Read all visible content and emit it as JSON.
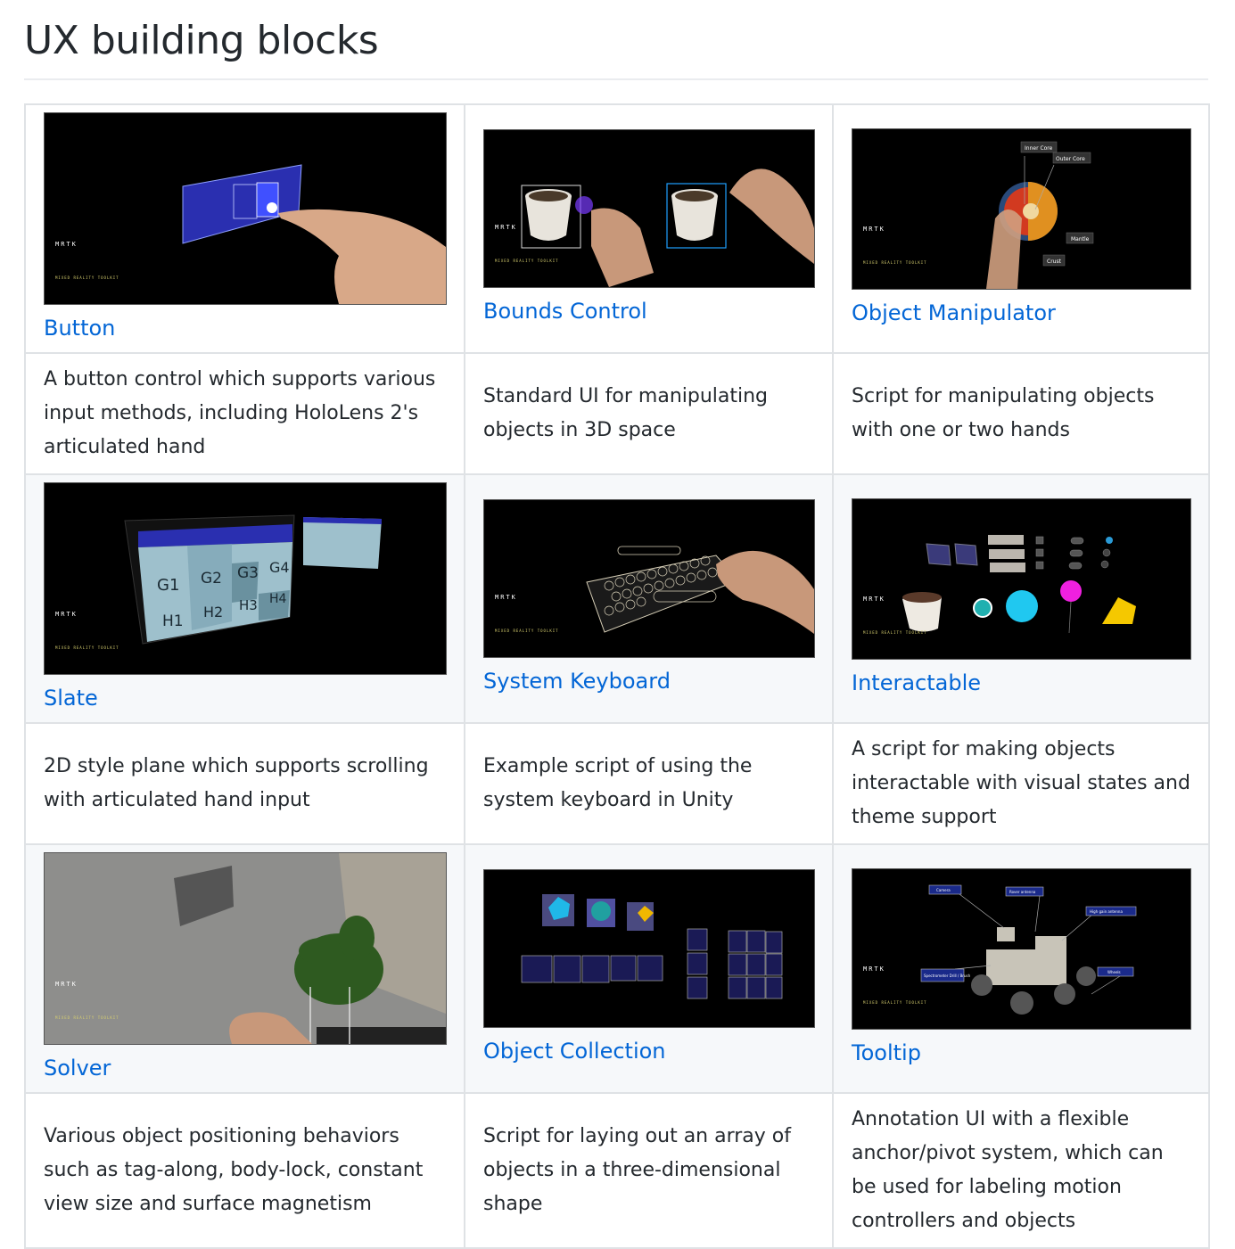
{
  "page": {
    "title": "UX building blocks"
  },
  "rows": [
    {
      "items": [
        {
          "name": "Button",
          "image": "button-demo-thumbnail",
          "description": "A button control which supports various input methods, including HoloLens 2's articulated hand"
        },
        {
          "name": "Bounds Control",
          "image": "bounds-control-demo-thumbnail",
          "description": "Standard UI for manipulating objects in 3D space"
        },
        {
          "name": "Object Manipulator",
          "image": "object-manipulator-demo-thumbnail",
          "description": "Script for manipulating objects with one or two hands"
        }
      ]
    },
    {
      "items": [
        {
          "name": "Slate",
          "image": "slate-demo-thumbnail",
          "description": "2D style plane which supports scrolling with articulated hand input"
        },
        {
          "name": "System Keyboard",
          "image": "system-keyboard-demo-thumbnail",
          "description": "Example script of using the system keyboard in Unity"
        },
        {
          "name": "Interactable",
          "image": "interactable-demo-thumbnail",
          "description": "A script for making objects interactable with visual states and theme support"
        }
      ]
    },
    {
      "items": [
        {
          "name": "Solver",
          "image": "solver-demo-thumbnail",
          "description": "Various object positioning behaviors such as tag-along, body-lock, constant view size and surface magnetism"
        },
        {
          "name": "Object Collection",
          "image": "object-collection-demo-thumbnail",
          "description": "Script for laying out an array of objects in a three-dimensional shape"
        },
        {
          "name": "Tooltip",
          "image": "tooltip-demo-thumbnail",
          "description": "Annotation UI with a flexible anchor/pivot system, which can be used for labeling motion controllers and objects"
        }
      ]
    }
  ],
  "thumbnail_text": {
    "logo": "MRTK",
    "logo_sub": "MIXED REALITY TOOLKIT",
    "earth_labels": [
      "Inner Core",
      "Outer Core",
      "Mantle",
      "Crust"
    ],
    "slate_cells": [
      "G1",
      "G2",
      "G3",
      "G4",
      "H1",
      "H2",
      "H3",
      "H4"
    ],
    "tooltip_labels": [
      "Camera",
      "Rover antenna",
      "High gain antenna",
      "Spectrometer Drill / Brush",
      "Wheels"
    ]
  },
  "colors": {
    "link": "#0366d6",
    "text": "#24292e",
    "border": "#dfe2e5",
    "alt_row": "#f6f8fa"
  }
}
